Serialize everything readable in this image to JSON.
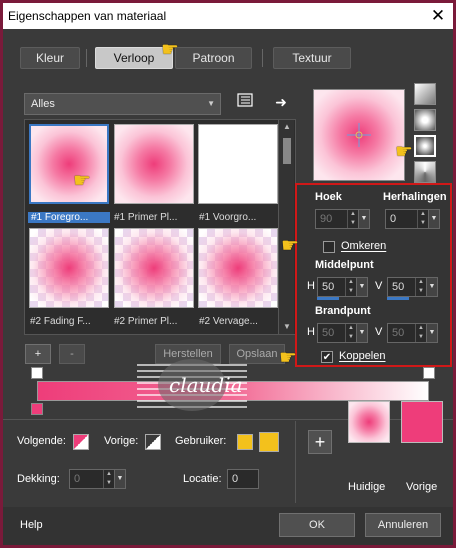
{
  "window": {
    "title": "Eigenschappen van materiaal",
    "close": "✕"
  },
  "tabs": [
    "Kleur",
    "Verloop",
    "Patroon",
    "Textuur"
  ],
  "dropdown": {
    "value": "Alles"
  },
  "gallery": {
    "items": [
      {
        "caption": "#1 Foregro..."
      },
      {
        "caption": "#1 Primer Pl..."
      },
      {
        "caption": "#1 Voorgro..."
      },
      {
        "caption": "#2 Fading F..."
      },
      {
        "caption": "#2 Primer Pl..."
      },
      {
        "caption": "#2 Vervage..."
      }
    ]
  },
  "buttons": {
    "add": "+",
    "remove": "-",
    "reset": "Herstellen",
    "save": "Opslaan",
    "ok": "OK",
    "cancel": "Annuleren",
    "help": "Help"
  },
  "panel": {
    "angle_label": "Hoek",
    "angle_value": "90",
    "repeats_label": "Herhalingen",
    "repeats_value": "0",
    "invert_label": "Omkeren",
    "center_label": "Middelpunt",
    "center_h": "50",
    "center_v": "50",
    "focal_label": "Brandpunt",
    "focal_h": "50",
    "focal_v": "50",
    "link_label": "Koppelen",
    "h": "H",
    "v": "V"
  },
  "bottom": {
    "next_label": "Volgende:",
    "prev_label": "Vorige:",
    "user_label": "Gebruiker:",
    "opacity_label": "Dekking:",
    "opacity_value": "0",
    "location_label": "Locatie:",
    "location_value": "0",
    "current_label": "Huidige",
    "previous_label": "Vorige"
  },
  "watermark": {
    "text": "claudia"
  },
  "colors": {
    "pink": "#ee3d7a",
    "accent": "#3b78c4",
    "highlight": "#d01818",
    "yellow": "#f3c11c"
  }
}
